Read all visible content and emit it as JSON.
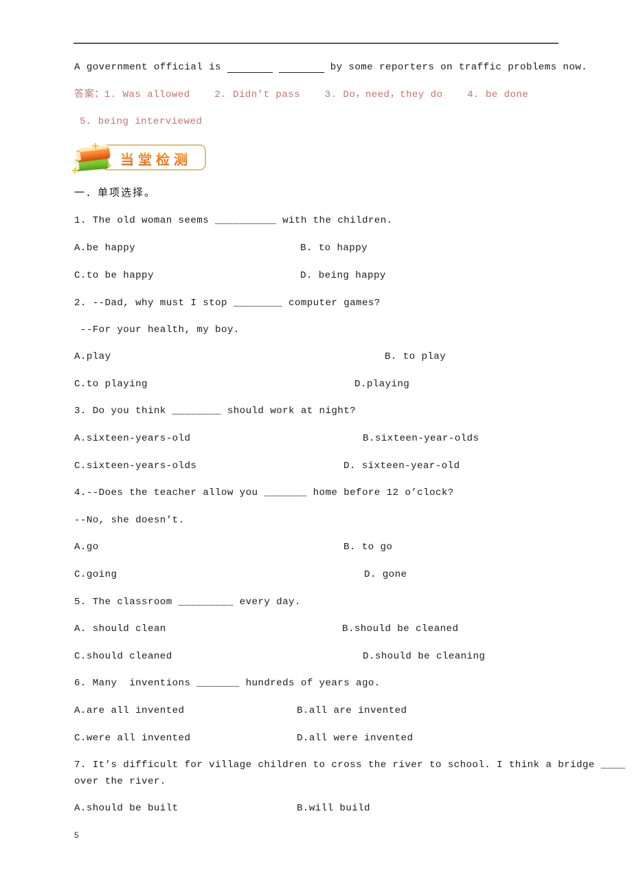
{
  "document": {
    "page_number": "5",
    "answer_color": "#c2756c",
    "rule_color": "#585858"
  },
  "top_sentence": {
    "before": "A government official is ",
    "blank1": "",
    "mid": " ",
    "blank2": "",
    "after": " by some reporters on traffic problems now.",
    "full": "A government official is ________ ________ by some reporters on traffic problems now."
  },
  "answers": {
    "line1": "答案：1. Was allowed    2. Didn’t pass    3. Do，need，they do    4. be done",
    "line2": "5. being interviewed",
    "label": "答案：",
    "items": [
      "1. Was allowed",
      "2. Didn’t pass",
      "3. Do，need，they do",
      "4. be done",
      "5. being interviewed"
    ]
  },
  "banner": {
    "title": "当堂检测",
    "icon": "stacked-books-icon",
    "frame_color": "#e0c07a",
    "text_gradient": [
      "#f7b33a",
      "#ef7c22",
      "#d85c10"
    ]
  },
  "section_heading": "一．单项选择。",
  "questions": [
    {
      "number": "1",
      "stem": "1. The old woman seems __________ with the children.",
      "options": [
        {
          "key": "A",
          "text": "A.be happy"
        },
        {
          "key": "B",
          "text": "B. to happy"
        },
        {
          "key": "C",
          "text": "C.to be happy"
        },
        {
          "key": "D",
          "text": "D. being happy"
        }
      ]
    },
    {
      "number": "2",
      "stem": "2. --Dad, why must I stop ________ computer games?",
      "stem2": " --For your health, my boy.",
      "options": [
        {
          "key": "A",
          "text": "A.play"
        },
        {
          "key": "B",
          "text": "B. to play"
        },
        {
          "key": "C",
          "text": "C.to playing"
        },
        {
          "key": "D",
          "text": "D.playing"
        }
      ]
    },
    {
      "number": "3",
      "stem": "3. Do you think ________ should work at night?",
      "options": [
        {
          "key": "A",
          "text": "A.sixteen-years-old"
        },
        {
          "key": "B",
          "text": "B.sixteen-year-olds"
        },
        {
          "key": "C",
          "text": "C.sixteen-years-olds"
        },
        {
          "key": "D",
          "text": "D. sixteen-year-old"
        }
      ]
    },
    {
      "number": "4",
      "stem": "4.--Does the teacher allow you _______ home before 12 o’clock?",
      "stem2": "--No, she doesn’t.",
      "options": [
        {
          "key": "A",
          "text": "A.go"
        },
        {
          "key": "B",
          "text": "B. to go"
        },
        {
          "key": "C",
          "text": "C.going"
        },
        {
          "key": "D",
          "text": "D. gone"
        }
      ]
    },
    {
      "number": "5",
      "stem": "5. The classroom _________ every day.",
      "options": [
        {
          "key": "A",
          "text": "A. should clean"
        },
        {
          "key": "B",
          "text": "B.should be cleaned"
        },
        {
          "key": "C",
          "text": "C.should cleaned"
        },
        {
          "key": "D",
          "text": "D.should be cleaning"
        }
      ]
    },
    {
      "number": "6",
      "stem": "6. Many  inventions _______ hundreds of years ago.",
      "options": [
        {
          "key": "A",
          "text": "A.are all invented"
        },
        {
          "key": "B",
          "text": "B.all are invented"
        },
        {
          "key": "C",
          "text": "C.were all invented"
        },
        {
          "key": "D",
          "text": "D.all were invented"
        }
      ]
    },
    {
      "number": "7",
      "stem": "7. It’s difficult for village children to cross the river to school. I think a bridge ____",
      "stem2": "over the river.",
      "options": [
        {
          "key": "A",
          "text": "A.should be built"
        },
        {
          "key": "B",
          "text": "B.will build"
        }
      ]
    }
  ]
}
